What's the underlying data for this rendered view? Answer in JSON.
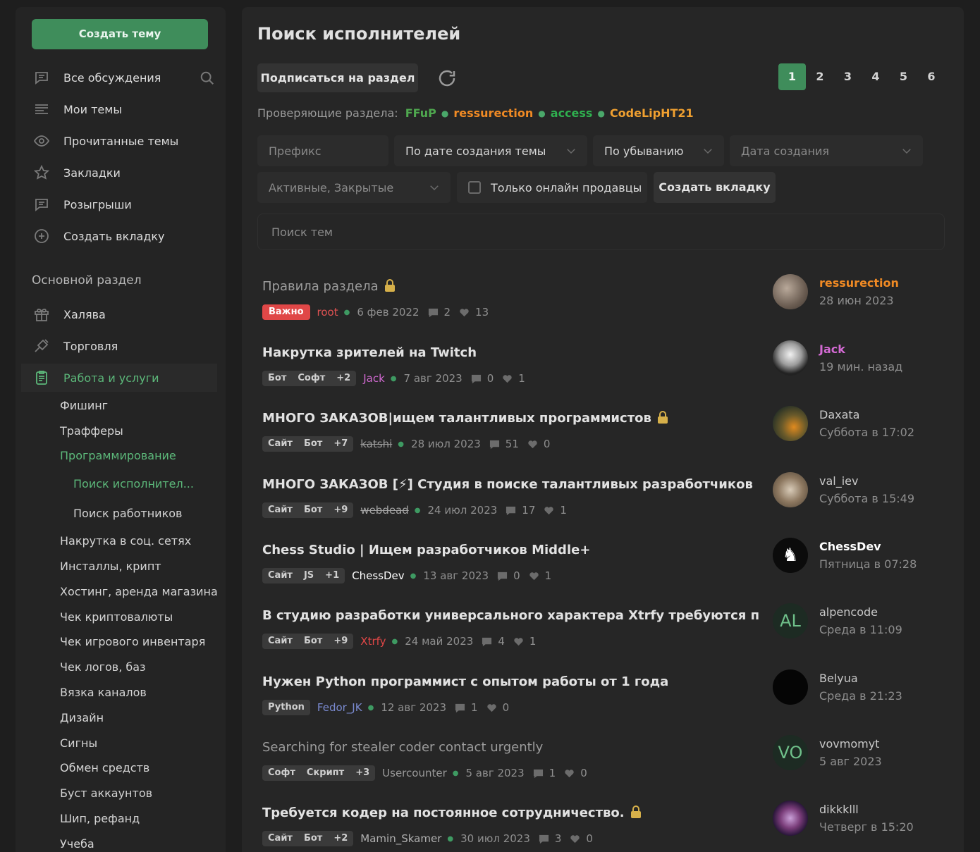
{
  "sidebar": {
    "create_topic": "Создать тему",
    "nav": [
      {
        "label": "Все обсуждения"
      },
      {
        "label": "Мои темы"
      },
      {
        "label": "Прочитанные темы"
      },
      {
        "label": "Закладки"
      },
      {
        "label": "Розыгрыши"
      },
      {
        "label": "Создать вкладку"
      }
    ],
    "section_title": "Основной раздел",
    "sections": [
      {
        "label": "Халява"
      },
      {
        "label": "Торговля"
      },
      {
        "label": "Работа и услуги"
      }
    ],
    "subs": [
      "Фишинг",
      "Трафферы",
      "Программирование",
      "Поиск исполнител...",
      "Поиск работников",
      "Накрутка в соц. сетях",
      "Инсталлы, крипт",
      "Хостинг, аренда магазина",
      "Чек криптовалюты",
      "Чек игрового инвентаря",
      "Чек логов, баз",
      "Вязка каналов",
      "Дизайн",
      "Сигны",
      "Обмен средств",
      "Буст аккаунтов",
      "Шип, рефанд",
      "Учеба"
    ]
  },
  "main": {
    "title": "Поиск исполнителей",
    "subscribe": "Подписаться на раздел",
    "pages": [
      "1",
      "2",
      "3",
      "4",
      "5",
      "6"
    ],
    "moderators_label": "Проверяющие раздела:",
    "moderators": [
      "FFuP",
      "ressurection",
      "access",
      "CodeLipHT21"
    ],
    "filters": {
      "prefix": "Префикс",
      "sort_by": "По дате создания темы",
      "order": "По убыванию",
      "date": "Дата создания",
      "state": "Активные, Закрытые",
      "online_only": "Только онлайн продавцы",
      "create_tab": "Создать вкладку",
      "search_placeholder": "Поиск тем"
    },
    "threads": [
      {
        "title": "Правила раздела",
        "locked": true,
        "important": "Важно",
        "tags": [],
        "author": "root",
        "date": "6 фев 2022",
        "replies": "2",
        "likes": "13",
        "last_user": "ressurection",
        "last_date": "28 июн 2023"
      },
      {
        "title": "Накрутка зрителей на Twitch",
        "tags": [
          "Бот",
          "Софт",
          "+2"
        ],
        "author": "Jack",
        "date": "7 авг 2023",
        "replies": "0",
        "likes": "1",
        "last_user": "Jack",
        "last_date": "19 мин. назад"
      },
      {
        "title": "МНОГО ЗАКАЗОВ|ищем талантливых программистов",
        "locked": true,
        "tags": [
          "Сайт",
          "Бот",
          "+7"
        ],
        "author": "katshi",
        "date": "28 июл 2023",
        "replies": "51",
        "likes": "0",
        "last_user": "Daxata",
        "last_date": "Суббота в 17:02"
      },
      {
        "title": "МНОГО ЗАКАЗОВ [⚡] Студия в поиске талантливых разработчиков",
        "tags": [
          "Сайт",
          "Бот",
          "+9"
        ],
        "author": "webdead",
        "date": "24 июл 2023",
        "replies": "17",
        "likes": "1",
        "last_user": "val_iev",
        "last_date": "Суббота в 15:49"
      },
      {
        "title": "Chess Studio | Ищем разработчиков Middle+",
        "tags": [
          "Сайт",
          "JS",
          "+1"
        ],
        "author": "ChessDev",
        "date": "13 авг 2023",
        "replies": "0",
        "likes": "1",
        "last_user": "ChessDev",
        "last_date": "Пятница в 07:28"
      },
      {
        "title": "В студию разработки универсального характера Xtrfy требуются программис...",
        "tags": [
          "Сайт",
          "Бот",
          "+9"
        ],
        "author": "Xtrfy",
        "date": "24 май 2023",
        "replies": "4",
        "likes": "1",
        "last_user": "alpencode",
        "last_date": "Среда в 11:09",
        "avatar_text": "AL"
      },
      {
        "title": "Нужен Python программист с опытом работы от 1 года",
        "tags": [
          "Python"
        ],
        "author": "Fedor_JK",
        "date": "12 авг 2023",
        "replies": "1",
        "likes": "0",
        "last_user": "Belyua",
        "last_date": "Среда в 21:23"
      },
      {
        "title": "Searching for stealer coder contact urgently",
        "tags": [
          "Софт",
          "Скрипт",
          "+3"
        ],
        "author": "Usercounter",
        "date": "5 авг 2023",
        "replies": "1",
        "likes": "0",
        "last_user": "vovmomyt",
        "last_date": "5 авг 2023",
        "avatar_text": "VO"
      },
      {
        "title": "Требуется кодер на постоянное сотрудничество.",
        "locked": true,
        "tags": [
          "Сайт",
          "Бот",
          "+2"
        ],
        "author": "Mamin_Skamer",
        "date": "30 июл 2023",
        "replies": "3",
        "likes": "0",
        "last_user": "dikkklll",
        "last_date": "Четверг в 15:20"
      }
    ]
  },
  "colors": {
    "accent_green": "#3f8d5b",
    "important_red": "#e04747",
    "mod_orange": "#f08a24"
  }
}
